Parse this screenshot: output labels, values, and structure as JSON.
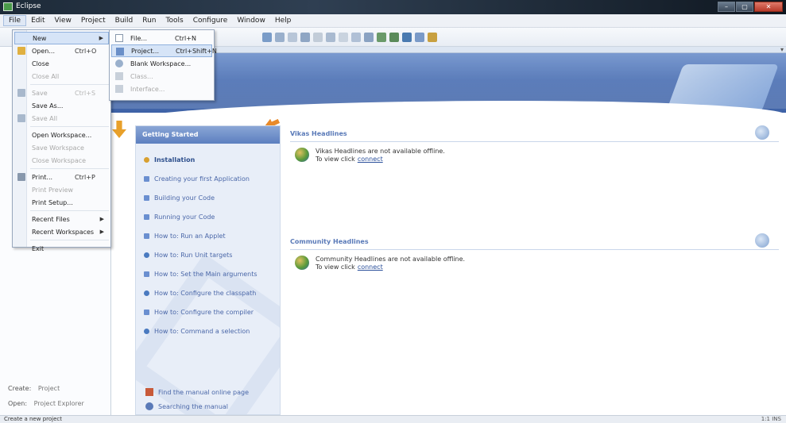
{
  "window": {
    "title": "Eclipse",
    "minimize": "–",
    "maximize": "▢",
    "close": "✕"
  },
  "menubar": {
    "items": [
      "File",
      "Edit",
      "View",
      "Project",
      "Build",
      "Run",
      "Tools",
      "Configure",
      "Window",
      "Help"
    ]
  },
  "file_menu": {
    "items": [
      {
        "label": "New",
        "shortcut": "",
        "submenu": true,
        "state": "highlight"
      },
      {
        "label": "Open...",
        "shortcut": "Ctrl+O",
        "submenu": false,
        "state": "normal"
      },
      {
        "label": "Close",
        "shortcut": "",
        "submenu": false,
        "state": "normal"
      },
      {
        "label": "Close All",
        "shortcut": "",
        "submenu": false,
        "state": "disabled"
      },
      {
        "label": "Save",
        "shortcut": "Ctrl+S",
        "submenu": false,
        "state": "disabled"
      },
      {
        "label": "Save As...",
        "shortcut": "",
        "submenu": false,
        "state": "normal"
      },
      {
        "label": "Save All",
        "shortcut": "",
        "submenu": false,
        "state": "disabled"
      },
      {
        "label": "Open Workspace...",
        "shortcut": "",
        "submenu": false,
        "state": "normal"
      },
      {
        "label": "Save Workspace",
        "shortcut": "",
        "submenu": false,
        "state": "disabled"
      },
      {
        "label": "Close Workspace",
        "shortcut": "",
        "submenu": false,
        "state": "disabled"
      },
      {
        "label": "Print...",
        "shortcut": "Ctrl+P",
        "submenu": false,
        "state": "normal"
      },
      {
        "label": "Print Preview",
        "shortcut": "",
        "submenu": false,
        "state": "disabled"
      },
      {
        "label": "Print Setup...",
        "shortcut": "",
        "submenu": false,
        "state": "normal"
      },
      {
        "label": "Recent Files",
        "shortcut": "",
        "submenu": true,
        "state": "normal"
      },
      {
        "label": "Recent Workspaces",
        "shortcut": "",
        "submenu": true,
        "state": "normal"
      },
      {
        "label": "Exit",
        "shortcut": "",
        "submenu": false,
        "state": "normal"
      }
    ]
  },
  "new_submenu": {
    "items": [
      {
        "label": "File...",
        "shortcut": "Ctrl+N",
        "state": "normal"
      },
      {
        "label": "Project...",
        "shortcut": "Ctrl+Shift+N",
        "state": "highlight"
      },
      {
        "label": "Blank Workspace...",
        "shortcut": "",
        "state": "normal"
      },
      {
        "label": "Class...",
        "shortcut": "",
        "state": "disabled"
      },
      {
        "label": "Interface...",
        "shortcut": "",
        "state": "disabled"
      }
    ]
  },
  "getting_started": {
    "title": "Getting Started",
    "items": [
      "Installation",
      "Creating your first Application",
      "Building your Code",
      "Running your Code",
      "How to: Run an Applet",
      "How to: Run Unit targets",
      "How to: Set the Main arguments",
      "How to: Configure the classpath",
      "How to: Configure the compiler",
      "How to: Command a selection"
    ],
    "bottom": [
      "Find the manual online page",
      "Searching the manual"
    ]
  },
  "news": {
    "title": "Vikas Headlines",
    "text": "Vikas Headlines are not available offline.",
    "link_prefix": "To view click",
    "link": "connect"
  },
  "community": {
    "title": "Community Headlines",
    "text": "Community Headlines are not available offline.",
    "link_prefix": "To view click",
    "link": "connect"
  },
  "sidebar": {
    "create_label": "Create:",
    "create_value": "Project",
    "open_label": "Open:",
    "open_value": "Project Explorer"
  },
  "statusbar": {
    "text": "Create a new project",
    "right": "1:1 INS"
  }
}
